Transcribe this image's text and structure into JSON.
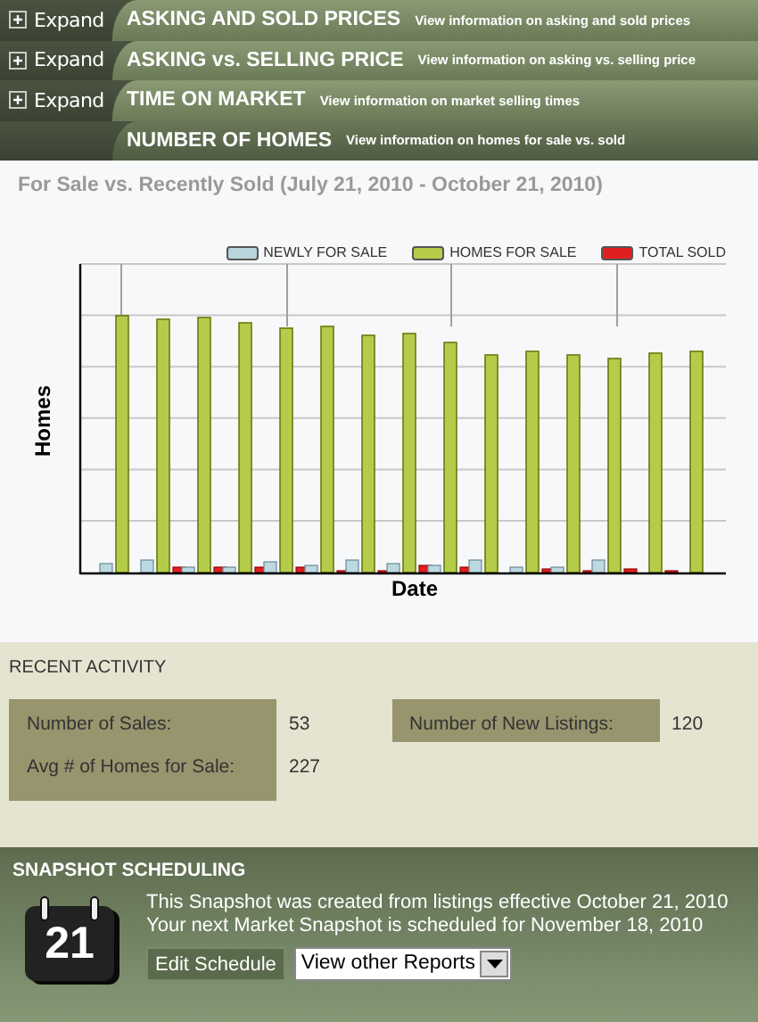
{
  "sections": [
    {
      "title": "ASKING AND SOLD PRICES",
      "description": "View information on asking and sold prices",
      "expand_label": "Expand",
      "selected": false
    },
    {
      "title": "ASKING vs. SELLING PRICE",
      "description": "View information on asking vs. selling price",
      "expand_label": "Expand",
      "selected": false
    },
    {
      "title": "TIME ON MARKET",
      "description": "View information on market selling times",
      "expand_label": "Expand",
      "selected": false
    },
    {
      "title": "NUMBER OF HOMES",
      "description": "View information on homes for sale vs. sold",
      "selected": true
    }
  ],
  "chart": {
    "title": "For Sale vs. Recently Sold (July 21, 2010 - October 21, 2010)",
    "xlabel": "Date",
    "ylabel": "Homes",
    "legend": [
      {
        "name": "NEWLY FOR SALE",
        "color": "#b8d4dc"
      },
      {
        "name": "HOMES FOR SALE",
        "color": "#b5cc4a"
      },
      {
        "name": "TOTAL SOLD",
        "color": "#e02020"
      }
    ]
  },
  "recent_activity": {
    "title": "RECENT ACTIVITY",
    "stats": [
      {
        "label": "Number of Sales:",
        "value": "53"
      },
      {
        "label": "Number of New Listings:",
        "value": "120"
      },
      {
        "label": "Avg # of Homes for Sale:",
        "value": "227"
      }
    ]
  },
  "scheduling": {
    "title": "SNAPSHOT SCHEDULING",
    "calendar_day": "21",
    "lines": [
      "This Snapshot was created from listings effective October 21, 2010",
      "Your next Market Snapshot is scheduled for November 18, 2010"
    ],
    "edit_button": "Edit Schedule",
    "reports_select": "View other Reports"
  }
}
